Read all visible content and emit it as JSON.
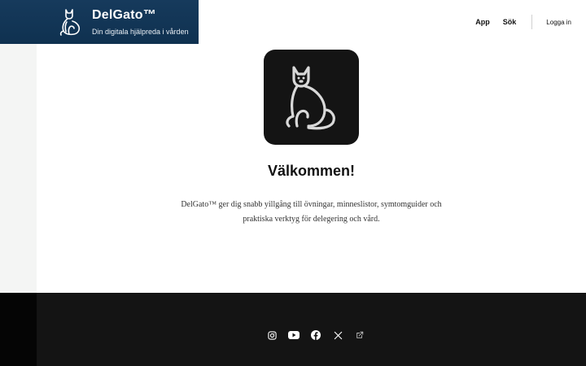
{
  "header": {
    "brand_name": "DelGato™",
    "tagline": "Din digitala hjälpreda i vården",
    "nav": {
      "app": "App",
      "search": "Sök",
      "login": "Logga in"
    }
  },
  "hero": {
    "title": "Välkommen!",
    "description": "DelGato™ ger dig snabb yillgång till övningar, minneslistor, symtomguider och praktiska verktyg för delegering och vård."
  },
  "footer": {
    "social_icons": [
      "instagram-icon",
      "youtube-icon",
      "facebook-icon",
      "x-icon",
      "external-link-icon"
    ]
  },
  "colors": {
    "brand_bg": "#163a5c",
    "footer_bg": "#141414",
    "hero_icon_bg": "#141414",
    "accent_line": "#d9d9d9"
  }
}
